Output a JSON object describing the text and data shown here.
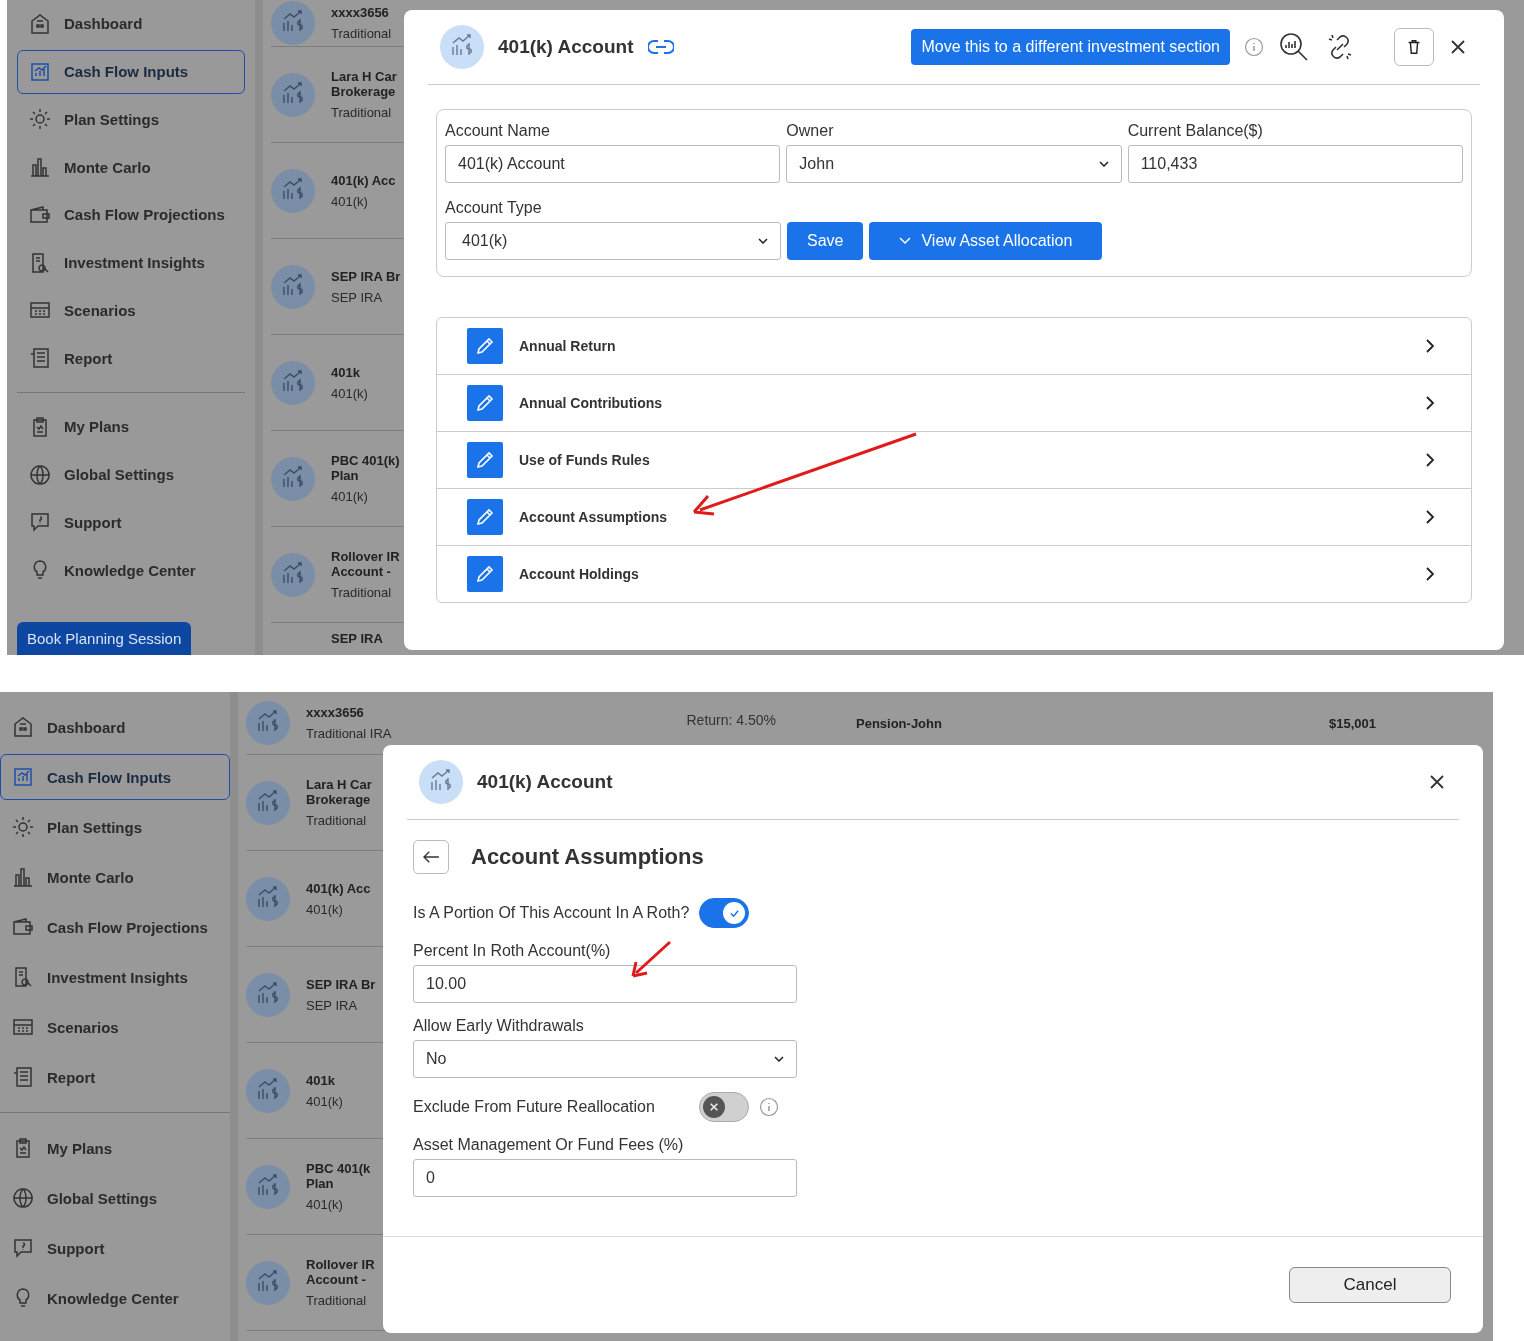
{
  "screen_1": {
    "sidebar": {
      "items": [
        {
          "label": "Dashboard",
          "selected": false
        },
        {
          "label": "Cash Flow Inputs",
          "selected": true
        },
        {
          "label": "Plan Settings",
          "selected": false
        },
        {
          "label": "Monte Carlo",
          "selected": false
        },
        {
          "label": "Cash Flow Projections",
          "selected": false
        },
        {
          "label": "Investment Insights",
          "selected": false
        },
        {
          "label": "Scenarios",
          "selected": false
        },
        {
          "label": "Report",
          "selected": false
        },
        {
          "label": "My Plans",
          "selected": false
        },
        {
          "label": "Global Settings",
          "selected": false
        },
        {
          "label": "Support",
          "selected": false
        },
        {
          "label": "Knowledge Center",
          "selected": false
        }
      ],
      "book_button": "Book Planning Session"
    },
    "accounts": [
      {
        "name_lines": [
          "xxxx3656"
        ],
        "type": "Traditional"
      },
      {
        "name_lines": [
          "Lara H Car",
          "Brokerage"
        ],
        "type": "Traditional"
      },
      {
        "name_lines": [
          "401(k) Acc"
        ],
        "type": "401(k)"
      },
      {
        "name_lines": [
          "SEP IRA Br"
        ],
        "type": "SEP IRA"
      },
      {
        "name_lines": [
          "401k"
        ],
        "type": "401(k)"
      },
      {
        "name_lines": [
          "PBC 401(k)",
          "Plan"
        ],
        "type": "401(k)"
      },
      {
        "name_lines": [
          "Rollover IR",
          "Account -"
        ],
        "type": "Traditional"
      },
      {
        "name_lines": [
          "SEP IRA"
        ]
      }
    ],
    "modal": {
      "title": "401(k) Account",
      "move_button": "Move this to a different investment section",
      "fields": [
        {
          "label": "Account Name",
          "value": "401(k) Account",
          "kind": "input"
        },
        {
          "label": "Owner",
          "value": "John",
          "kind": "select"
        },
        {
          "label": "Current Balance($)",
          "value": "110,433",
          "kind": "input"
        }
      ],
      "account_type": {
        "label": "Account Type",
        "value": "401(k)"
      },
      "save_button": "Save",
      "allocation_button": "View Asset Allocation",
      "sections": [
        "Annual Return",
        "Annual Contributions",
        "Use of Funds Rules",
        "Account Assumptions",
        "Account Holdings"
      ]
    }
  },
  "screen_2": {
    "sidebar": {
      "items": [
        {
          "label": "Dashboard",
          "selected": false
        },
        {
          "label": "Cash Flow Inputs",
          "selected": true
        },
        {
          "label": "Plan Settings",
          "selected": false
        },
        {
          "label": "Monte Carlo",
          "selected": false
        },
        {
          "label": "Cash Flow Projections",
          "selected": false
        },
        {
          "label": "Investment Insights",
          "selected": false
        },
        {
          "label": "Scenarios",
          "selected": false
        },
        {
          "label": "Report",
          "selected": false
        },
        {
          "label": "My Plans",
          "selected": false
        },
        {
          "label": "Global Settings",
          "selected": false
        },
        {
          "label": "Support",
          "selected": false
        },
        {
          "label": "Knowledge Center",
          "selected": false
        }
      ]
    },
    "accounts": [
      {
        "name_lines": [
          "xxxx3656"
        ],
        "type": "Traditional IRA",
        "return": "Return: 4.50%"
      },
      {
        "name_lines": [
          "Lara H Car",
          "Brokerage"
        ],
        "type": "Traditional"
      },
      {
        "name_lines": [
          "401(k) Acc"
        ],
        "type": "401(k)"
      },
      {
        "name_lines": [
          "SEP IRA Br"
        ],
        "type": "SEP IRA"
      },
      {
        "name_lines": [
          "401k"
        ],
        "type": "401(k)"
      },
      {
        "name_lines": [
          "PBC 401(k",
          "Plan"
        ],
        "type": "401(k)"
      },
      {
        "name_lines": [
          "Rollover IR",
          "Account -"
        ],
        "type": "Traditional"
      }
    ],
    "side_card": {
      "name": "Pension-John",
      "amount": "$15,001"
    },
    "modal": {
      "title": "401(k) Account",
      "section_title": "Account Assumptions",
      "fields": [
        {
          "kind": "toggle",
          "label": "Is A Portion Of This Account In A Roth?",
          "on": true,
          "info": false
        },
        {
          "kind": "input",
          "label": "Percent In Roth Account(%)",
          "value": "10.00"
        },
        {
          "kind": "select",
          "label": "Allow Early Withdrawals",
          "value": "No"
        },
        {
          "kind": "toggle",
          "label": "Exclude From Future Reallocation",
          "on": false,
          "info": true
        },
        {
          "kind": "input",
          "label": "Asset Management Or Fund Fees (%)",
          "value": "0"
        }
      ],
      "cancel_button": "Cancel"
    }
  }
}
